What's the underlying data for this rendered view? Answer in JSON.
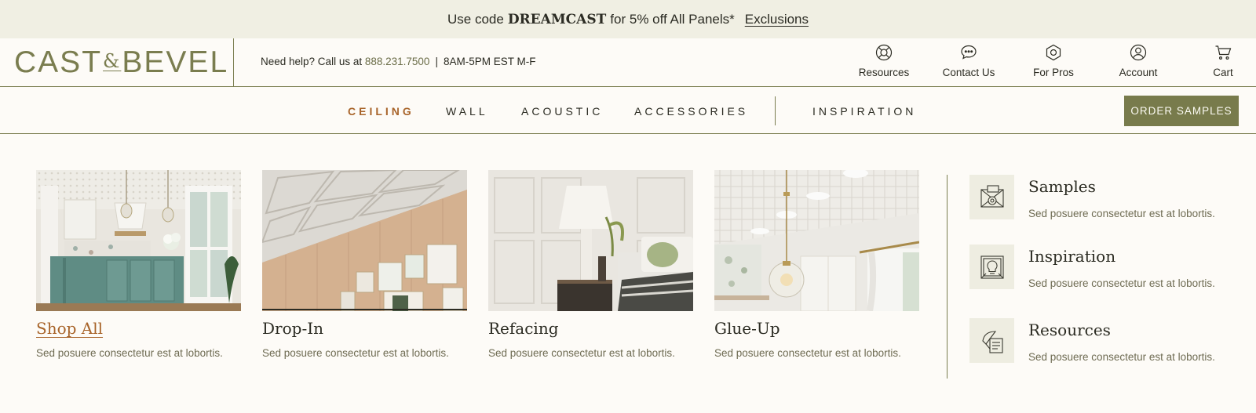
{
  "promo": {
    "prefix": "Use code",
    "code": "DREAMCAST",
    "suffix": "for 5% off All Panels*",
    "exclusions": "Exclusions"
  },
  "header": {
    "logo_left": "CAST",
    "logo_amp": "&",
    "logo_right": "BEVEL",
    "help_text": "Need help? Call us at",
    "phone": "888.231.7500",
    "separator": "|",
    "hours": "8AM-5PM EST M-F",
    "utility": [
      {
        "label": "Resources",
        "icon": "lifebuoy-icon"
      },
      {
        "label": "Contact Us",
        "icon": "chat-bubble-icon"
      },
      {
        "label": "For Pros",
        "icon": "hexagon-icon"
      },
      {
        "label": "Account",
        "icon": "user-icon"
      },
      {
        "label": "Cart",
        "icon": "cart-icon"
      }
    ]
  },
  "nav": {
    "items": [
      "CEILING",
      "WALL",
      "ACOUSTIC",
      "ACCESSORIES",
      "INSPIRATION"
    ],
    "active": "CEILING",
    "order_button": "ORDER SAMPLES"
  },
  "menu": {
    "cards": [
      {
        "title": "Shop All",
        "desc": "Sed posuere consectetur est at lobortis.",
        "active": true
      },
      {
        "title": "Drop-In",
        "desc": "Sed posuere consectetur est at lobortis."
      },
      {
        "title": "Refacing",
        "desc": "Sed posuere consectetur est at lobortis."
      },
      {
        "title": "Glue-Up",
        "desc": "Sed posuere consectetur est at lobortis."
      }
    ],
    "side": [
      {
        "title": "Samples",
        "desc": "Sed posuere consectetur est at lobortis.",
        "icon": "samples-icon"
      },
      {
        "title": "Inspiration",
        "desc": "Sed posuere consectetur est at lobortis.",
        "icon": "lightbulb-icon"
      },
      {
        "title": "Resources",
        "desc": "Sed posuere consectetur est at lobortis.",
        "icon": "documents-icon"
      }
    ]
  },
  "colors": {
    "brand_olive": "#787b4c",
    "accent_rust": "#a8642a",
    "promo_bg": "#f0efe3",
    "page_bg": "#fdfbf7"
  }
}
